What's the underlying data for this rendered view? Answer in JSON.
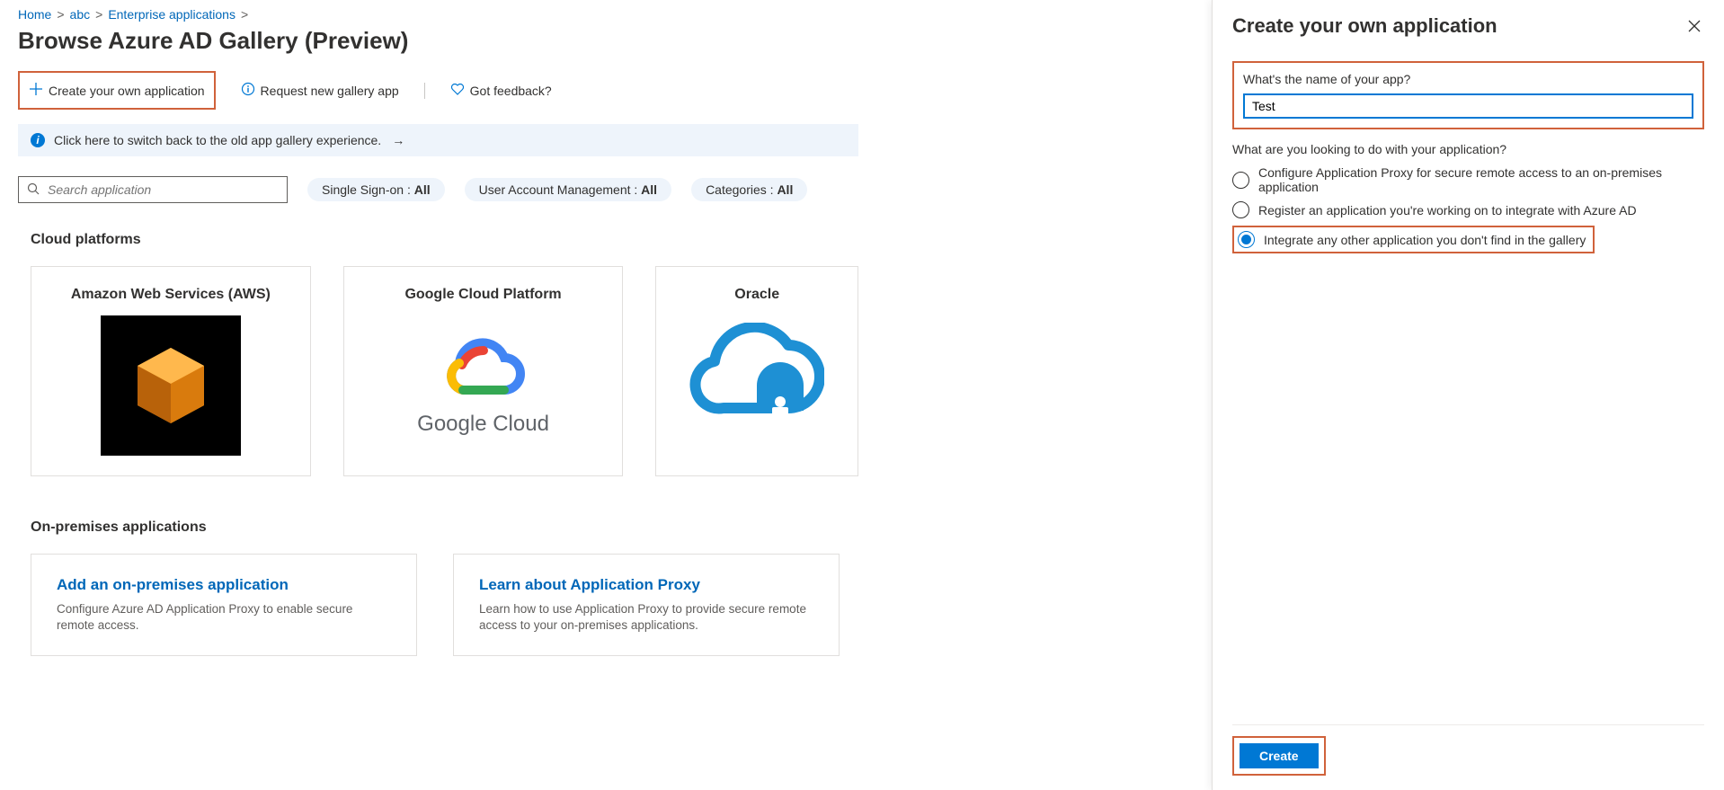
{
  "breadcrumb": {
    "items": [
      "Home",
      "abc",
      "Enterprise applications"
    ],
    "sep": ">"
  },
  "page_title": "Browse Azure AD Gallery (Preview)",
  "toolbar": {
    "create_app": "Create your own application",
    "request_app": "Request new gallery app",
    "feedback": "Got feedback?"
  },
  "infobar": {
    "text": "Click here to switch back to the old app gallery experience.",
    "arrow": "→"
  },
  "search": {
    "placeholder": "Search application"
  },
  "filters": {
    "sso_label": "Single Sign-on : ",
    "sso_value": "All",
    "uam_label": "User Account Management : ",
    "uam_value": "All",
    "cat_label": "Categories : ",
    "cat_value": "All"
  },
  "sections": {
    "cloud": "Cloud platforms",
    "onprem": "On-premises applications"
  },
  "cards": {
    "aws": "Amazon Web Services (AWS)",
    "gcp": "Google Cloud Platform",
    "gcp_logo_text": "Google Cloud",
    "oracle": "Oracle"
  },
  "onprem": {
    "add_title": "Add an on-premises application",
    "add_desc": "Configure Azure AD Application Proxy to enable secure remote access.",
    "learn_title": "Learn about Application Proxy",
    "learn_desc": "Learn how to use Application Proxy to provide secure remote access to your on-premises applications."
  },
  "panel": {
    "title": "Create your own application",
    "name_label": "What's the name of your app?",
    "name_value": "Test",
    "question": "What are you looking to do with your application?",
    "opt1": "Configure Application Proxy for secure remote access to an on-premises application",
    "opt2": "Register an application you're working on to integrate with Azure AD",
    "opt3": "Integrate any other application you don't find in the gallery",
    "create": "Create"
  }
}
